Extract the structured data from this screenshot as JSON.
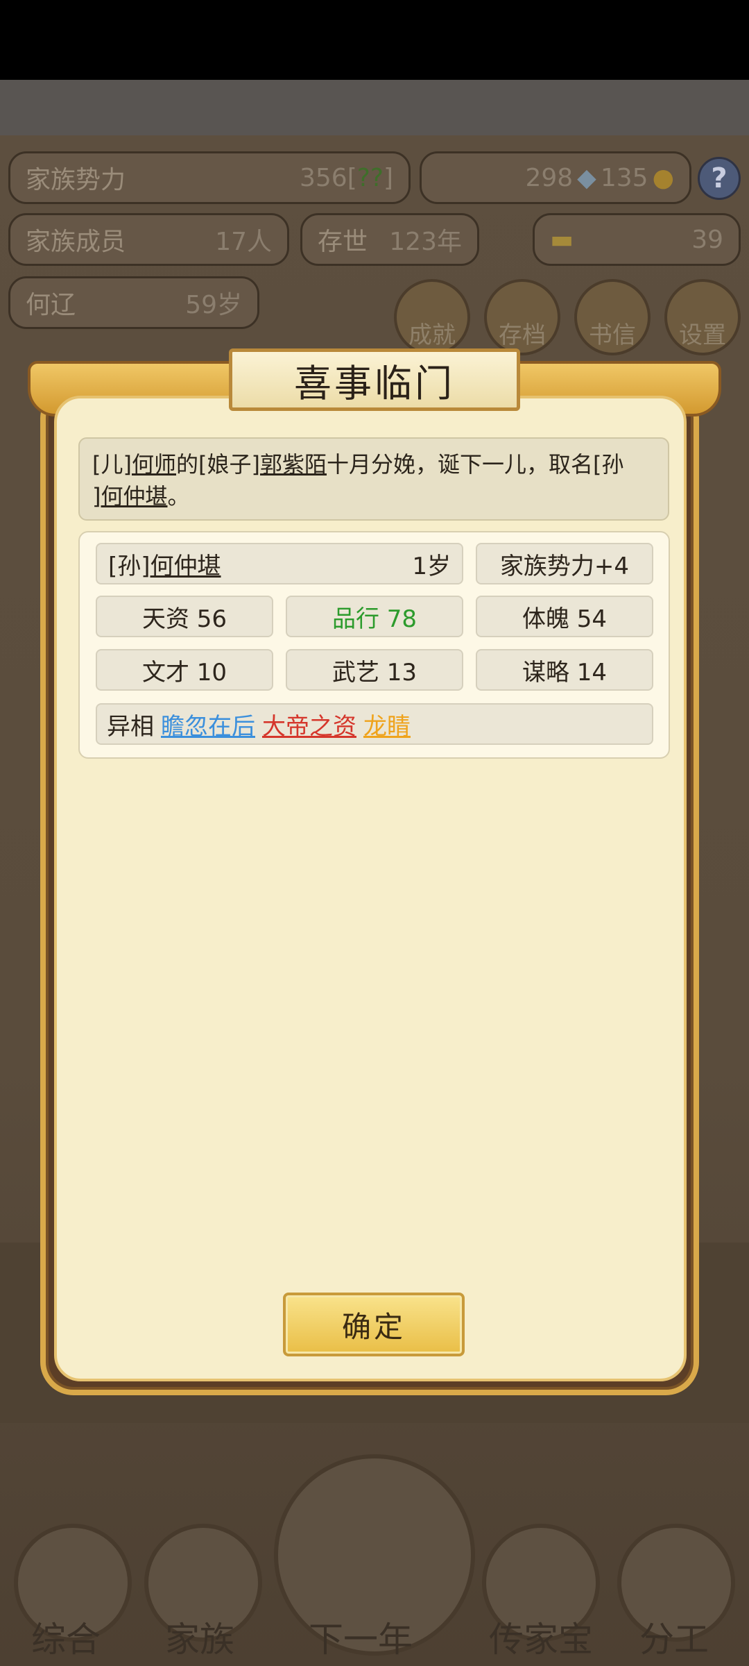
{
  "background": {
    "stats": {
      "power_label": "家族势力",
      "power_value": "356",
      "power_rank": "[",
      "power_rank_text": "??",
      "power_rank_end": "]",
      "currency_a": "298",
      "currency_b": "135",
      "members_label": "家族成员",
      "members_value": "17人",
      "alive_label": "存世",
      "alive_value": "123年",
      "gold_value": "39",
      "person_name": "何辽",
      "person_age": "59岁"
    },
    "menu_icons": [
      "成就",
      "存档",
      "书信",
      "设置"
    ],
    "bottom_nav": [
      "综合",
      "家族",
      "下一年",
      "传家宝",
      "分工"
    ]
  },
  "dialog": {
    "title": "喜事临门",
    "message": {
      "p1": "[儿]",
      "p2": "何师",
      "p3": "的",
      "p4": "[娘子]",
      "p5": "郭紫陌",
      "p6": "十月分娩，诞下一儿，取名",
      "p7": "[孙",
      "p8": "]",
      "p9": "何仲堪",
      "p10": "。"
    },
    "child": {
      "tag": "[孙]",
      "name": "何仲堪",
      "age": "1岁",
      "power_bonus": "家族势力+4"
    },
    "attributes": [
      {
        "label": "天资 56"
      },
      {
        "label": "品行 78"
      },
      {
        "label": "体魄 54"
      },
      {
        "label": "文才 10"
      },
      {
        "label": "武艺 13"
      },
      {
        "label": "谋略 14"
      }
    ],
    "traits_label": "异相",
    "traits": [
      "瞻忽在后",
      "大帝之资",
      "龙睛"
    ],
    "confirm_label": "确定"
  }
}
